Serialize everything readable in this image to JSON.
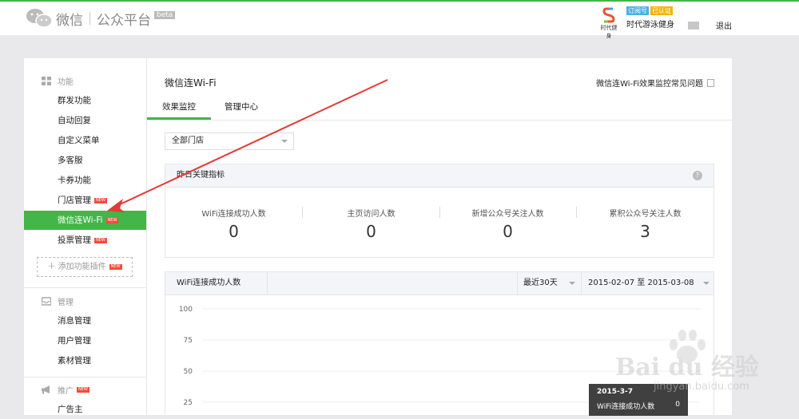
{
  "header": {
    "logo_text_1": "微信",
    "logo_text_2": "公众平台",
    "beta": "beta",
    "account_avatar_text": "时代健身",
    "badge_subscription": "订阅号",
    "badge_verified": "已认证",
    "account_name": "时代游泳健身",
    "logout": "退出",
    "brand_color": "#44b549"
  },
  "sidebar": {
    "sections": [
      {
        "label": "功能",
        "icon": "grid-icon"
      },
      {
        "label": "管理",
        "icon": "inbox-icon"
      },
      {
        "label": "推广",
        "icon": "megaphone-icon"
      }
    ],
    "func_items": [
      {
        "label": "群发功能",
        "new": ""
      },
      {
        "label": "自动回复",
        "new": ""
      },
      {
        "label": "自定义菜单",
        "new": ""
      },
      {
        "label": "多客服",
        "new": ""
      },
      {
        "label": "卡券功能",
        "new": ""
      },
      {
        "label": "门店管理",
        "new": "NEW"
      },
      {
        "label": "微信连Wi-Fi",
        "new": "NEW"
      },
      {
        "label": "投票管理",
        "new": "NEW"
      }
    ],
    "add_plugin": "添加功能插件",
    "add_plugin_new": "NEW",
    "manage_items": [
      "消息管理",
      "用户管理",
      "素材管理"
    ],
    "promo_new": "NEW",
    "promo_items": [
      "广告主"
    ]
  },
  "main": {
    "title": "微信连Wi-Fi",
    "faq": "微信连Wi-Fi效果监控常见问题",
    "tabs": [
      "效果监控",
      "管理中心"
    ],
    "store_select": "全部门店",
    "kpi": {
      "title": "昨日关键指标",
      "help": "?",
      "items": [
        {
          "label": "WiFi连接成功人数",
          "value": "0"
        },
        {
          "label": "主页访问人数",
          "value": "0"
        },
        {
          "label": "新增公众号关注人数",
          "value": "0"
        },
        {
          "label": "累积公众号关注人数",
          "value": "3"
        }
      ]
    },
    "trend": {
      "metric": "WiFi连接成功人数",
      "range": "最近30天",
      "dates": "2015-02-07 至 2015-03-08"
    }
  },
  "chart_data": {
    "type": "line",
    "y_ticks": [
      "100",
      "75",
      "50",
      "25"
    ],
    "ylim": [
      0,
      100
    ],
    "series": [
      {
        "name": "WiFi连接成功人数",
        "values": [
          0
        ]
      }
    ],
    "tooltip": {
      "date": "2015-3-7",
      "label": "WiFi连接成功人数",
      "value": "0"
    }
  },
  "watermark": {
    "brand": "Bai du 经验",
    "url": "jingyan.baidu.com"
  }
}
